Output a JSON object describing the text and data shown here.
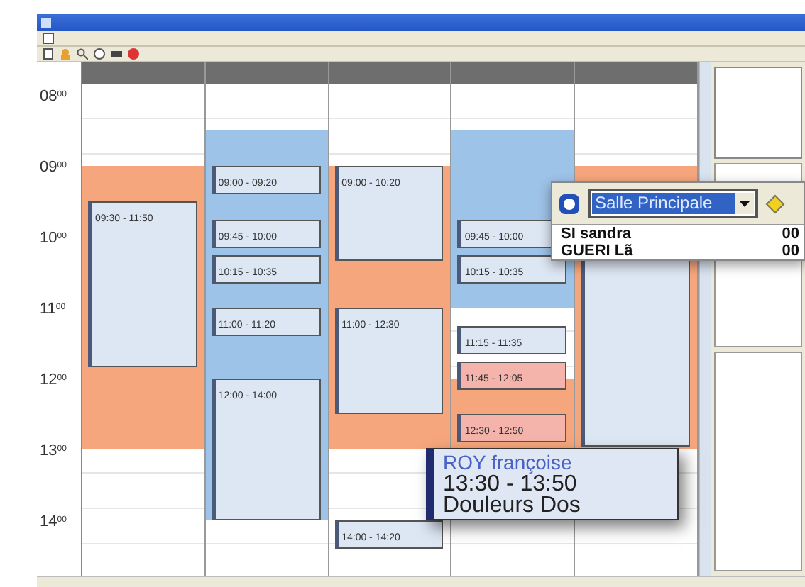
{
  "hours": [
    {
      "hour": "08",
      "minutes": "00"
    },
    {
      "hour": "09",
      "minutes": "00"
    },
    {
      "hour": "10",
      "minutes": "00"
    },
    {
      "hour": "11",
      "minutes": "00"
    },
    {
      "hour": "12",
      "minutes": "00"
    },
    {
      "hour": "13",
      "minutes": "00"
    },
    {
      "hour": "14",
      "minutes": "00"
    }
  ],
  "columns": [
    {
      "slots": [
        {
          "kind": "free"
        },
        {
          "kind": "free"
        },
        {
          "kind": "unavailable"
        },
        {
          "kind": "unavailable"
        },
        {
          "kind": "unavailable"
        },
        {
          "kind": "unavailable"
        },
        {
          "kind": "unavailable"
        },
        {
          "kind": "unavailable"
        },
        {
          "kind": "unavailable"
        },
        {
          "kind": "unavailable"
        },
        {
          "kind": "free"
        },
        {
          "kind": "free"
        },
        {
          "kind": "free"
        },
        {
          "kind": "free"
        }
      ],
      "events": [
        {
          "time": "09:30 - 11:50",
          "color": "#dde6f3"
        }
      ]
    },
    {
      "slots": [
        {
          "kind": "free"
        },
        {
          "kind": "visits"
        },
        {
          "kind": "visits"
        },
        {
          "kind": "visits"
        },
        {
          "kind": "visits"
        },
        {
          "kind": "visits"
        },
        {
          "kind": "visits"
        },
        {
          "kind": "visits"
        },
        {
          "kind": "visits"
        },
        {
          "kind": "visits"
        },
        {
          "kind": "visits"
        },
        {
          "kind": "visits"
        },
        {
          "kind": "free"
        },
        {
          "kind": "free"
        }
      ],
      "events": [
        {
          "time": "09:00 - 09:20",
          "color": "#dde6f3"
        },
        {
          "time": "09:45 - 10:00",
          "color": "#dde6f3"
        },
        {
          "time": "10:15 - 10:35",
          "color": "#dde6f3"
        },
        {
          "time": "11:00 - 11:20",
          "color": "#dde6f3"
        },
        {
          "time": "12:00 - 14:00",
          "color": "#dde6f3"
        }
      ]
    },
    {
      "slots": [
        {
          "kind": "free"
        },
        {
          "kind": "free"
        },
        {
          "kind": "unavailable"
        },
        {
          "kind": "unavailable"
        },
        {
          "kind": "unavailable"
        },
        {
          "kind": "unavailable"
        },
        {
          "kind": "unavailable"
        },
        {
          "kind": "unavailable"
        },
        {
          "kind": "unavailable"
        },
        {
          "kind": "unavailable"
        },
        {
          "kind": "free"
        },
        {
          "kind": "free"
        },
        {
          "kind": "free"
        },
        {
          "kind": "free"
        }
      ],
      "events": [
        {
          "time": "09:00 - 10:20",
          "color": "#dde6f3"
        },
        {
          "time": "11:00 - 12:30",
          "color": "#dde6f3"
        },
        {
          "time": "14:00 - 14:20",
          "color": "#dde6f3"
        }
      ]
    },
    {
      "slots": [
        {
          "kind": "free"
        },
        {
          "kind": "visits"
        },
        {
          "kind": "visits"
        },
        {
          "kind": "visits"
        },
        {
          "kind": "visits"
        },
        {
          "kind": "visits"
        },
        {
          "kind": "free"
        },
        {
          "kind": "free"
        },
        {
          "kind": "unavailable"
        },
        {
          "kind": "unavailable"
        },
        {
          "kind": "free"
        },
        {
          "kind": "free"
        },
        {
          "kind": "free"
        },
        {
          "kind": "free"
        }
      ],
      "events": [
        {
          "time": "09:45 - 10:00",
          "color": "#dde6f3"
        },
        {
          "time": "10:15 - 10:35",
          "color": "#dde6f3"
        },
        {
          "time": "11:15 - 11:35",
          "color": "#dde6f3"
        },
        {
          "time": "11:45 - 12:05",
          "color": "#f4b3ab"
        },
        {
          "time": "12:30 - 12:50",
          "color": "#f4b3ab"
        }
      ]
    },
    {
      "slots": [
        {
          "kind": "free"
        },
        {
          "kind": "free"
        },
        {
          "kind": "unavailable"
        },
        {
          "kind": "booked"
        },
        {
          "kind": "booked"
        },
        {
          "kind": "booked"
        },
        {
          "kind": "booked"
        },
        {
          "kind": "booked"
        },
        {
          "kind": "booked"
        },
        {
          "kind": "booked"
        },
        {
          "kind": "free"
        },
        {
          "kind": "free"
        },
        {
          "kind": "free"
        },
        {
          "kind": "free"
        }
      ]
    }
  ],
  "room_picker": {
    "value": "Salle Principale",
    "rows": [
      {
        "name": "SI sandra",
        "value": "00"
      },
      {
        "name": "GUERI Lã",
        "value": "00"
      }
    ]
  },
  "tooltip": {
    "patient": "ROY françoise",
    "time": "13:30 - 13:50",
    "reason": "Douleurs Dos"
  }
}
